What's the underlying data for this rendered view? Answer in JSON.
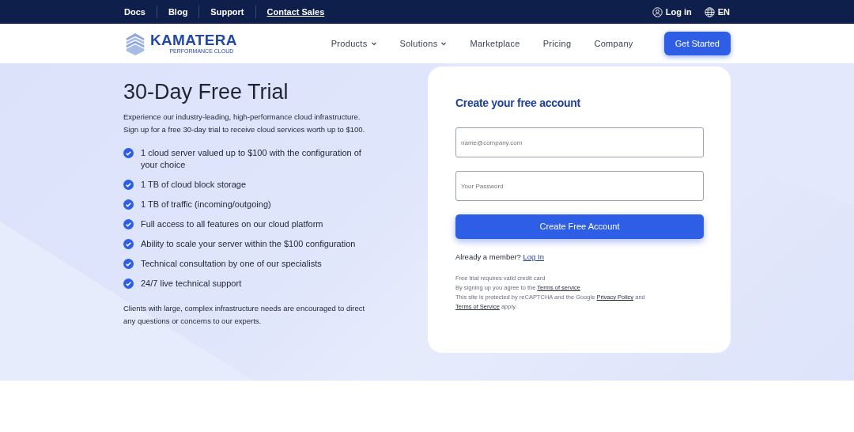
{
  "top_links": [
    {
      "label": "Docs",
      "underlined": false
    },
    {
      "label": "Blog",
      "underlined": false
    },
    {
      "label": "Support",
      "underlined": false
    },
    {
      "label": "Contact Sales",
      "underlined": true
    }
  ],
  "top_right": {
    "login": "Log in",
    "language": "EN"
  },
  "logo": {
    "name": "KAMATERA",
    "tagline": "PERFORMANCE CLOUD"
  },
  "nav": [
    {
      "label": "Products",
      "dropdown": true
    },
    {
      "label": "Solutions",
      "dropdown": true
    },
    {
      "label": "Marketplace",
      "dropdown": false
    },
    {
      "label": "Pricing",
      "dropdown": false
    },
    {
      "label": "Company",
      "dropdown": false
    }
  ],
  "cta": "Get Started",
  "hero": {
    "title": "30-Day Free Trial",
    "intro": "Experience our industry-leading, high-performance cloud infrastructure. Sign up for a free 30-day trial to receive cloud services worth up to $100.",
    "features": [
      {
        "text": "1 cloud server valued up to $100 with the configuration of your choice",
        "checked": true
      },
      {
        "text": "1 TB of cloud block storage",
        "checked": true
      },
      {
        "text": "1 TB of traffic (incoming/outgoing)",
        "checked": true
      },
      {
        "text": "Full access to all features on our cloud platform",
        "checked": true
      },
      {
        "text": "Ability to scale your server within the $100 configuration",
        "checked": true
      },
      {
        "text": "Technical consultation by one of our specialists",
        "checked": true
      },
      {
        "text": "24/7 live technical support",
        "checked": true
      }
    ],
    "note": "Clients with large, complex infrastructure needs are encouraged to direct any questions or concerns to our experts."
  },
  "form": {
    "title": "Create your free account",
    "email": {
      "placeholder": "name@company.com"
    },
    "password": {
      "placeholder": "Your Password"
    },
    "submit": "Create Free Account",
    "member": [
      {
        "kind": "text",
        "text": "Already a member?"
      },
      {
        "kind": "link",
        "text": "Log In"
      }
    ],
    "legal": [
      [
        {
          "kind": "text",
          "text": "Free trial requires valid credit card"
        }
      ],
      [
        {
          "kind": "text",
          "text": "By signing up you agree to the"
        },
        {
          "kind": "link",
          "text": "Terms of service"
        }
      ],
      [
        {
          "kind": "text",
          "text": "This site is protected by reCAPTCHA and the Google"
        },
        {
          "kind": "link",
          "text": "Privacy Policy"
        },
        {
          "kind": "text",
          "text": "and"
        }
      ],
      [
        {
          "kind": "link",
          "text": "Terms of Service"
        },
        {
          "kind": "text",
          "text": "apply."
        }
      ]
    ]
  }
}
